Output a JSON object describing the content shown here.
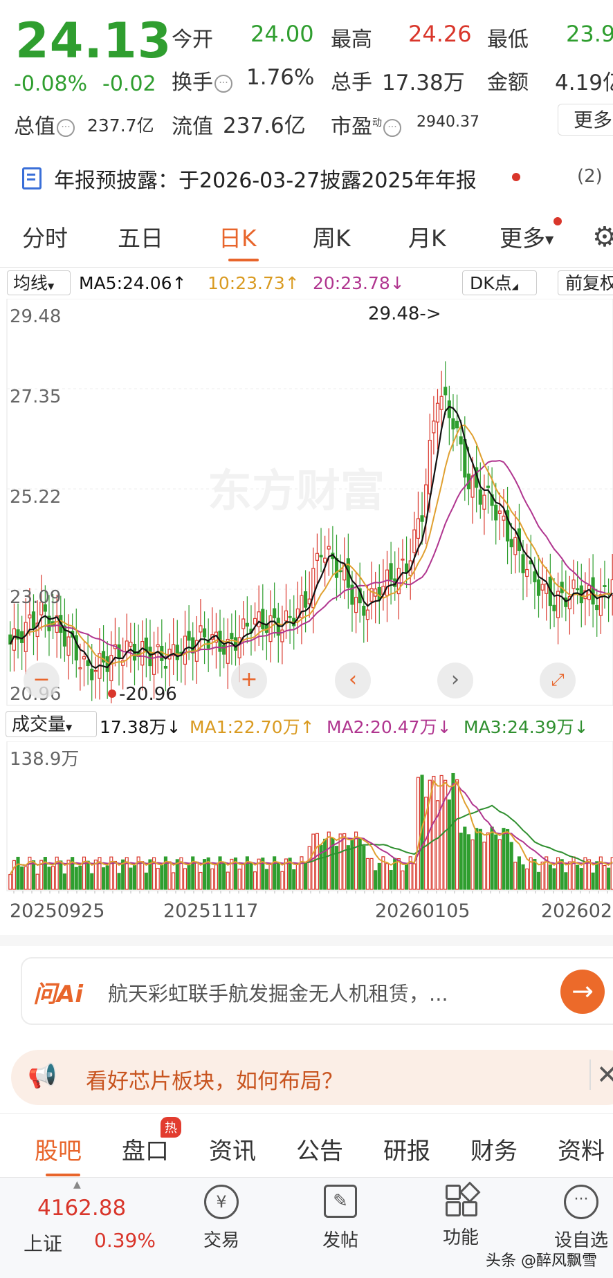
{
  "quote": {
    "price": "24.13",
    "change_pct": "-0.08%",
    "change": "-0.02",
    "open_label": "今开",
    "open": "24.00",
    "high_label": "最高",
    "high": "24.26",
    "low_label": "最低",
    "low": "23.9",
    "turnover_label": "换手",
    "turnover": "1.76%",
    "volume_label": "总手",
    "volume": "17.38万",
    "amount_label": "金额",
    "amount": "4.19亿",
    "mktcap_label": "总值",
    "mktcap": "237.7亿",
    "float_label": "流值",
    "float": "237.6亿",
    "pe_label": "市盈",
    "pe_sup": "动",
    "pe": "2940.37",
    "more_button": "更多"
  },
  "notice": {
    "text": "年报预披露：于2026-03-27披露2025年年报",
    "count": "(2)"
  },
  "period_tabs": [
    "分时",
    "五日",
    "日K",
    "周K",
    "月K",
    "更多"
  ],
  "active_period": 2,
  "ma_bar": {
    "selector": "均线",
    "ma5": "MA5:24.06↑",
    "ma10": "10:23.73↑",
    "ma20": "20:23.78↓",
    "dk_button": "DK点",
    "fq_button": "前复权"
  },
  "price_chart": {
    "y_labels": [
      "29.48",
      "27.35",
      "25.22",
      "23.09",
      "20.96"
    ],
    "max_annotation": "29.48->",
    "min_annotation": "-20.96",
    "watermark": "东方财富"
  },
  "volume_bar": {
    "selector": "成交量",
    "value": "17.38万↓",
    "ma1": "MA1:22.70万↑",
    "ma2": "MA2:20.47万↓",
    "ma3": "MA3:24.39万↓",
    "max_label": "138.9万"
  },
  "dates": [
    "20250925",
    "20251117",
    "20260105",
    "2026022"
  ],
  "ai_bar": {
    "logo": "问Ai",
    "text": "航天彩虹联手航发掘金无人机租赁，..."
  },
  "promo": {
    "text": "看好芯片板块，如何布局？"
  },
  "bottom_tabs": [
    "股吧",
    "盘口",
    "资讯",
    "公告",
    "研报",
    "财务",
    "资料"
  ],
  "hot_badge": "热",
  "nav": {
    "index_value": "4162.88",
    "index_name": "上证",
    "index_change": "0.39%",
    "trade": "交易",
    "post": "发帖",
    "function": "功能",
    "watchlist": "设自选"
  },
  "watermark_footer": "头条 @醉风飘雪",
  "colors": {
    "up": "#d9362b",
    "down": "#2f9e2f",
    "accent": "#e8652b",
    "ma5": "#111111",
    "ma10": "#e0a030",
    "ma20": "#b0358f"
  }
}
